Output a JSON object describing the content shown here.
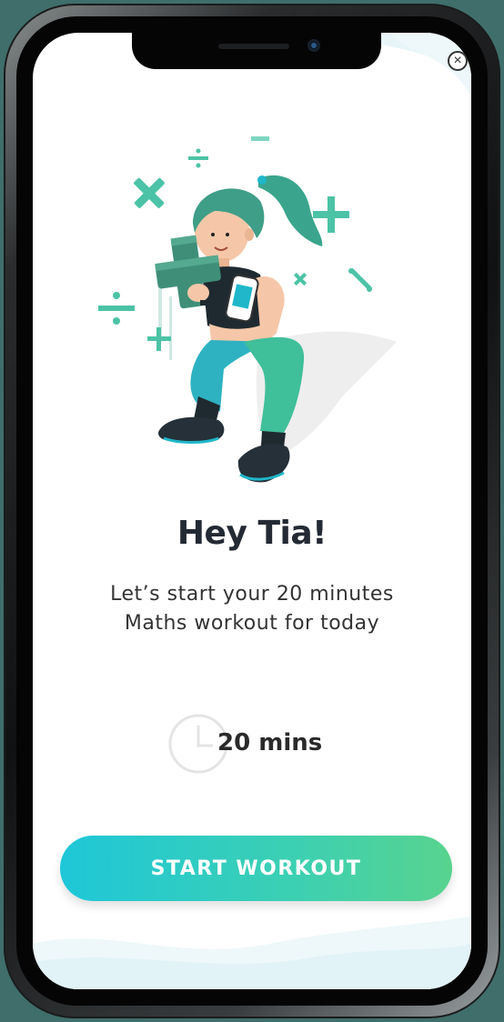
{
  "screen": {
    "greeting": "Hey Tia!",
    "message_line1": "Let’s start your 20 minutes",
    "message_line2": "Maths workout for today",
    "duration": "20 mins",
    "start_button": "START WORKOUT",
    "close_symbol": "×"
  },
  "icons": {
    "close": "close-icon",
    "clock": "clock-icon",
    "illustration": "fitness-girl-illustration"
  },
  "colors": {
    "accent_start": "#1ec7d8",
    "accent_end": "#58d38e",
    "math_symbol": "#4cc3a6",
    "title_text": "#242a33"
  }
}
